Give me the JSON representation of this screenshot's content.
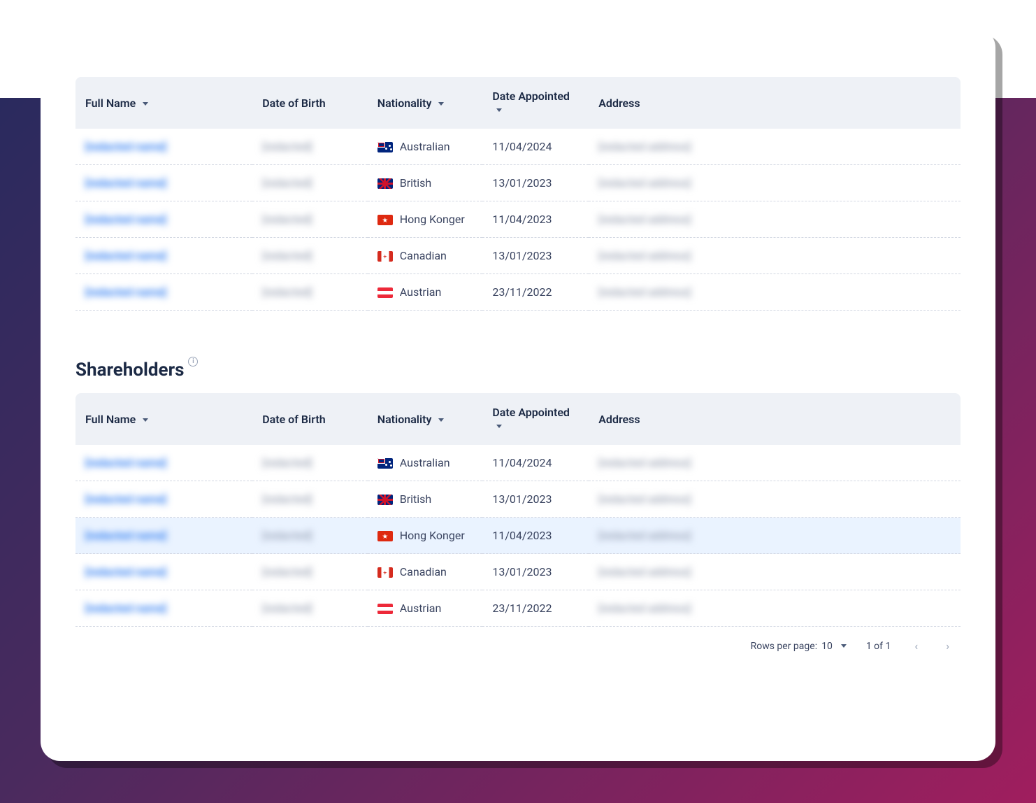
{
  "headers": {
    "full_name": "Full Name",
    "date_of_birth": "Date of Birth",
    "nationality": "Nationality",
    "date_appointed": "Date Appointed",
    "address": "Address"
  },
  "sections": {
    "shareholders_title": "Shareholders"
  },
  "table1": {
    "rows": [
      {
        "name": "[redacted name]",
        "dob": "[redacted]",
        "nat": "Australian",
        "natFlag": "au",
        "date": "11/04/2024",
        "addr": "[redacted address]"
      },
      {
        "name": "[redacted name]",
        "dob": "[redacted]",
        "nat": "British",
        "natFlag": "gb",
        "date": "13/01/2023",
        "addr": "[redacted address]"
      },
      {
        "name": "[redacted name]",
        "dob": "[redacted]",
        "nat": "Hong Konger",
        "natFlag": "hk",
        "date": "11/04/2023",
        "addr": "[redacted address]"
      },
      {
        "name": "[redacted name]",
        "dob": "[redacted]",
        "nat": "Canadian",
        "natFlag": "ca",
        "date": "13/01/2023",
        "addr": "[redacted address]"
      },
      {
        "name": "[redacted name]",
        "dob": "[redacted]",
        "nat": "Austrian",
        "natFlag": "at",
        "date": "23/11/2022",
        "addr": "[redacted address]"
      }
    ]
  },
  "table2": {
    "rows": [
      {
        "name": "[redacted name]",
        "dob": "[redacted]",
        "nat": "Australian",
        "natFlag": "au",
        "date": "11/04/2024",
        "addr": "[redacted address]"
      },
      {
        "name": "[redacted name]",
        "dob": "[redacted]",
        "nat": "British",
        "natFlag": "gb",
        "date": "13/01/2023",
        "addr": "[redacted address]"
      },
      {
        "name": "[redacted name]",
        "dob": "[redacted]",
        "nat": "Hong Konger",
        "natFlag": "hk",
        "date": "11/04/2023",
        "addr": "[redacted address]",
        "hover": true
      },
      {
        "name": "[redacted name]",
        "dob": "[redacted]",
        "nat": "Canadian",
        "natFlag": "ca",
        "date": "13/01/2023",
        "addr": "[redacted address]"
      },
      {
        "name": "[redacted name]",
        "dob": "[redacted]",
        "nat": "Austrian",
        "natFlag": "at",
        "date": "23/11/2022",
        "addr": "[redacted address]"
      }
    ]
  },
  "pagination": {
    "rows_label": "Rows per page:",
    "rows_value": "10",
    "page_info": "1 of 1"
  }
}
